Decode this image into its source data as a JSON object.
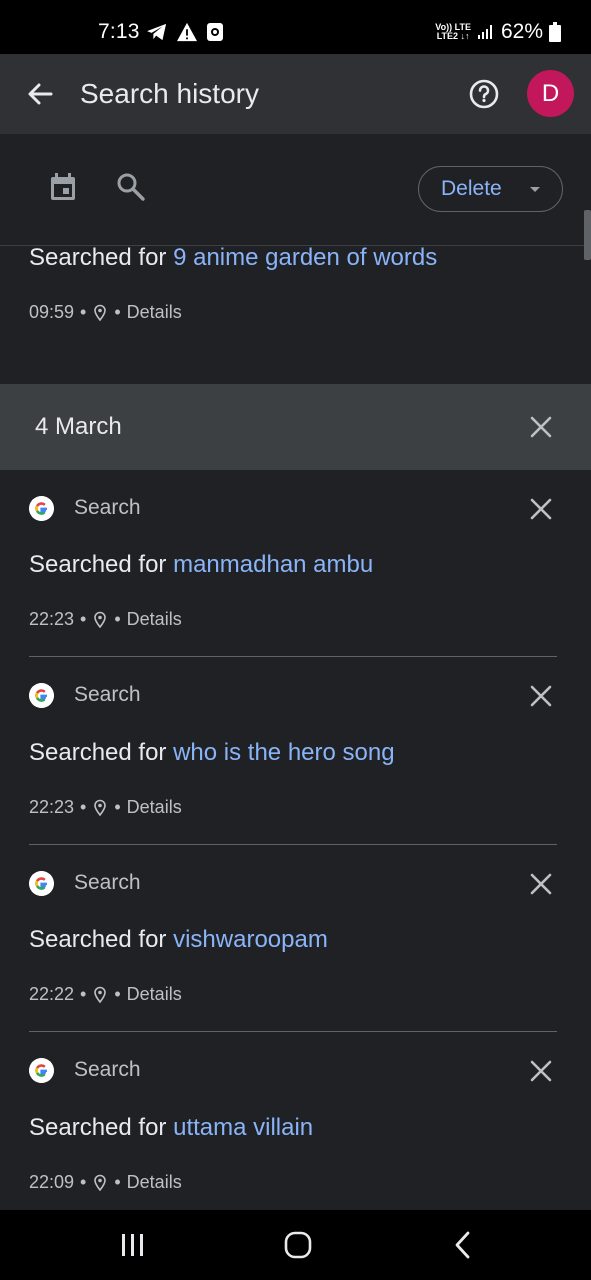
{
  "status_bar": {
    "time": "7:13",
    "network_top": "Vo)) LTE",
    "network_bottom": "LTE2 ↓↑",
    "battery": "62%"
  },
  "app_bar": {
    "title": "Search history",
    "avatar_letter": "D"
  },
  "toolbar": {
    "delete_label": "Delete"
  },
  "top_entry": {
    "prefix": "Searched for",
    "query": "9 anime garden of words",
    "time": "09:59",
    "details": "Details"
  },
  "date_group": {
    "label": "4 March"
  },
  "entries": [
    {
      "source": "Search",
      "prefix": "Searched for",
      "query": "manmadhan ambu",
      "time": "22:23",
      "details": "Details"
    },
    {
      "source": "Search",
      "prefix": "Searched for",
      "query": "who is the hero song",
      "time": "22:23",
      "details": "Details"
    },
    {
      "source": "Search",
      "prefix": "Searched for",
      "query": "vishwaroopam",
      "time": "22:22",
      "details": "Details"
    },
    {
      "source": "Search",
      "prefix": "Searched for",
      "query": "uttama villain",
      "time": "22:09",
      "details": "Details"
    }
  ],
  "colors": {
    "background": "#202124",
    "app_bar": "#303134",
    "date_header": "#3c4043",
    "link": "#8ab4f8",
    "avatar": "#c2185b"
  },
  "icons": {
    "back": "arrow-back-icon",
    "help": "help-circle-icon",
    "calendar": "calendar-icon",
    "search": "search-icon",
    "close": "close-icon",
    "location": "location-pin-icon",
    "google": "google-g-icon",
    "recents": "recents-icon",
    "home": "home-icon",
    "nav_back": "nav-back-icon"
  }
}
